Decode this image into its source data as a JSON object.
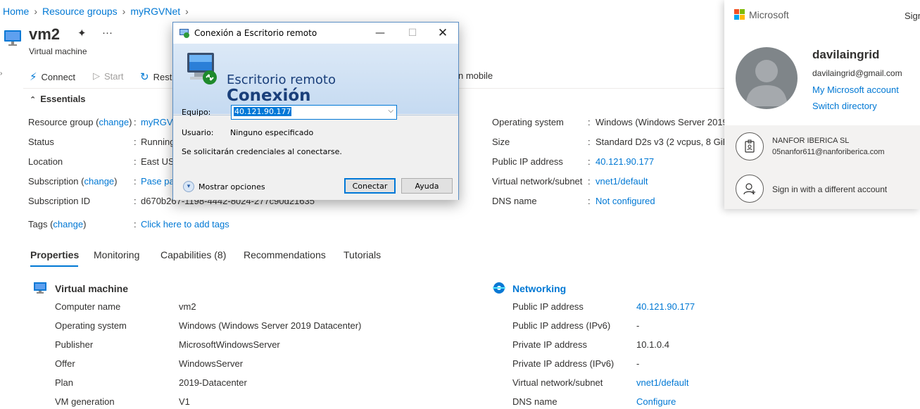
{
  "breadcrumb": [
    "Home",
    "Resource groups",
    "myRGVNet"
  ],
  "resource": {
    "name": "vm2",
    "type": "Virtual machine"
  },
  "toolbar": {
    "connect": "Connect",
    "start": "Start",
    "restart": "Rest",
    "mobile": "n mobile"
  },
  "essentials": {
    "header": "Essentials",
    "left": [
      {
        "label": "Resource group",
        "change": "change",
        "value": "myRGVN"
      },
      {
        "label": "Status",
        "value": "Running"
      },
      {
        "label": "Location",
        "value": "East US"
      },
      {
        "label": "Subscription",
        "change": "change",
        "value": "Pase pa"
      },
      {
        "label": "Subscription ID",
        "value": "d670b267-1198-4442-8024-277c90d21635"
      }
    ],
    "right": [
      {
        "label": "Operating system",
        "value": "Windows (Windows Server 2019"
      },
      {
        "label": "Size",
        "value": "Standard D2s v3 (2 vcpus, 8 GiB"
      },
      {
        "label": "Public IP address",
        "value": "40.121.90.177"
      },
      {
        "label": "Virtual network/subnet",
        "value": "vnet1/default"
      },
      {
        "label": "DNS name",
        "value": "Not configured"
      }
    ],
    "tags_label": "Tags",
    "tags_change": "change",
    "tags_value": "Click here to add tags"
  },
  "tabs": [
    "Properties",
    "Monitoring",
    "Capabilities (8)",
    "Recommendations",
    "Tutorials"
  ],
  "vm_section": {
    "title": "Virtual machine",
    "rows": [
      {
        "label": "Computer name",
        "value": "vm2"
      },
      {
        "label": "Operating system",
        "value": "Windows (Windows Server 2019 Datacenter)"
      },
      {
        "label": "Publisher",
        "value": "MicrosoftWindowsServer"
      },
      {
        "label": "Offer",
        "value": "WindowsServer"
      },
      {
        "label": "Plan",
        "value": "2019-Datacenter"
      },
      {
        "label": "VM generation",
        "value": "V1"
      }
    ]
  },
  "net_section": {
    "title": "Networking",
    "rows": [
      {
        "label": "Public IP address",
        "value": "40.121.90.177"
      },
      {
        "label": "Public IP address (IPv6)",
        "value": "-"
      },
      {
        "label": "Private IP address",
        "value": "10.1.0.4"
      },
      {
        "label": "Private IP address (IPv6)",
        "value": "-"
      },
      {
        "label": "Virtual network/subnet",
        "value": "vnet1/default"
      },
      {
        "label": "DNS name",
        "value": "Configure"
      }
    ]
  },
  "rdp": {
    "title": "Conexión a Escritorio remoto",
    "banner_line1": "Escritorio remoto",
    "banner_line2": "Conexión",
    "equipo_label": "Equipo:",
    "equipo_value": "40.121.90.177",
    "usuario_label": "Usuario:",
    "usuario_value": "Ninguno especificado",
    "note": "Se solicitarán credenciales al conectarse.",
    "options": "Mostrar opciones",
    "connect": "Conectar",
    "help": "Ayuda"
  },
  "account": {
    "brand": "Microsoft",
    "signout": "Sign",
    "username": "davilaingrid",
    "email": "davilaingrid@gmail.com",
    "my_account": "My Microsoft account",
    "switch_dir": "Switch directory",
    "org_name": "NANFOR IBERICA SL",
    "org_email": "05nanfor611@nanforiberica.com",
    "other_account": "Sign in with a different account"
  }
}
